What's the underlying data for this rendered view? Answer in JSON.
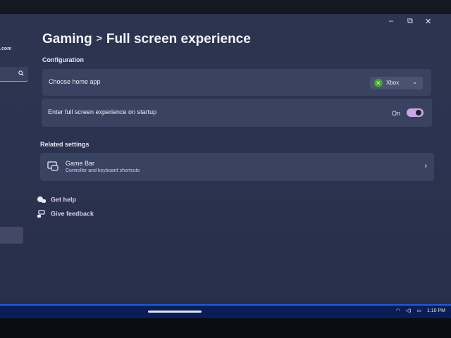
{
  "window": {
    "minimize": "–",
    "maximize": "⧉",
    "close": "✕"
  },
  "sidebar": {
    "account_fragment": ".com"
  },
  "header": {
    "parent": "Gaming",
    "separator": ">",
    "title": "Full screen experience"
  },
  "sections": {
    "configuration": "Configuration",
    "related": "Related settings"
  },
  "config": {
    "home_app_label": "Choose home app",
    "home_app_value": "Xbox",
    "startup_label": "Enter full screen experience on startup",
    "startup_state": "On"
  },
  "related": {
    "game_bar_title": "Game Bar",
    "game_bar_subtitle": "Controller and keyboard shortcuts"
  },
  "help": {
    "get_help": "Get help",
    "give_feedback": "Give feedback"
  },
  "taskbar": {
    "time": "1:10 PM"
  },
  "colors": {
    "accent": "#c7a9e6",
    "link": "#dcc9f5",
    "taskbar": "#0b1d57"
  }
}
